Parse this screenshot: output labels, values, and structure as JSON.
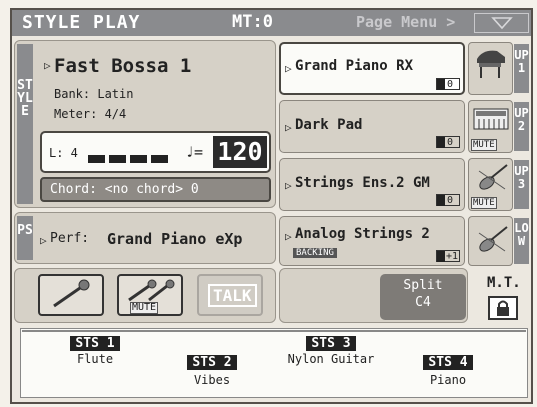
{
  "header": {
    "title": "STYLE PLAY",
    "mt": "MT:0",
    "menu": "Page Menu >"
  },
  "style": {
    "side_label": "STYLE",
    "name": "Fast Bossa 1",
    "bank": "Bank: Latin",
    "meter": "Meter:  4/4",
    "length": "L: 4",
    "tempo_symbol": "♩=",
    "tempo": "120",
    "chord": "Chord: <no chord> 0"
  },
  "performance": {
    "side_label": "PS",
    "label": "Perf:",
    "name": "Grand Piano eXp"
  },
  "sounds": [
    {
      "name": "Grand Piano RX",
      "octave": "0",
      "track": "UP1",
      "mute": ""
    },
    {
      "name": "Dark Pad",
      "octave": "0",
      "track": "UP2",
      "mute": "MUTE"
    },
    {
      "name": "Strings Ens.2 GM",
      "octave": "0",
      "track": "UP3",
      "mute": "MUTE"
    },
    {
      "name": "Analog Strings 2",
      "octave": "+1",
      "track": "LOW",
      "mute": "",
      "sub": "BACKING"
    }
  ],
  "controls": {
    "mic_mute": "MUTE",
    "talk": "TALK",
    "split_label": "Split",
    "split_note": "C4",
    "mt_label": "M.T."
  },
  "sts": [
    {
      "tag": "STS 1",
      "name": "Flute"
    },
    {
      "tag": "STS 2",
      "name": "Vibes"
    },
    {
      "tag": "STS 3",
      "name": "Nylon Guitar"
    },
    {
      "tag": "STS 4",
      "name": "Piano"
    }
  ],
  "colors": {
    "header": "#8a8b8e",
    "panel": "#d6d1c7",
    "selected": "#fbfbf8"
  }
}
